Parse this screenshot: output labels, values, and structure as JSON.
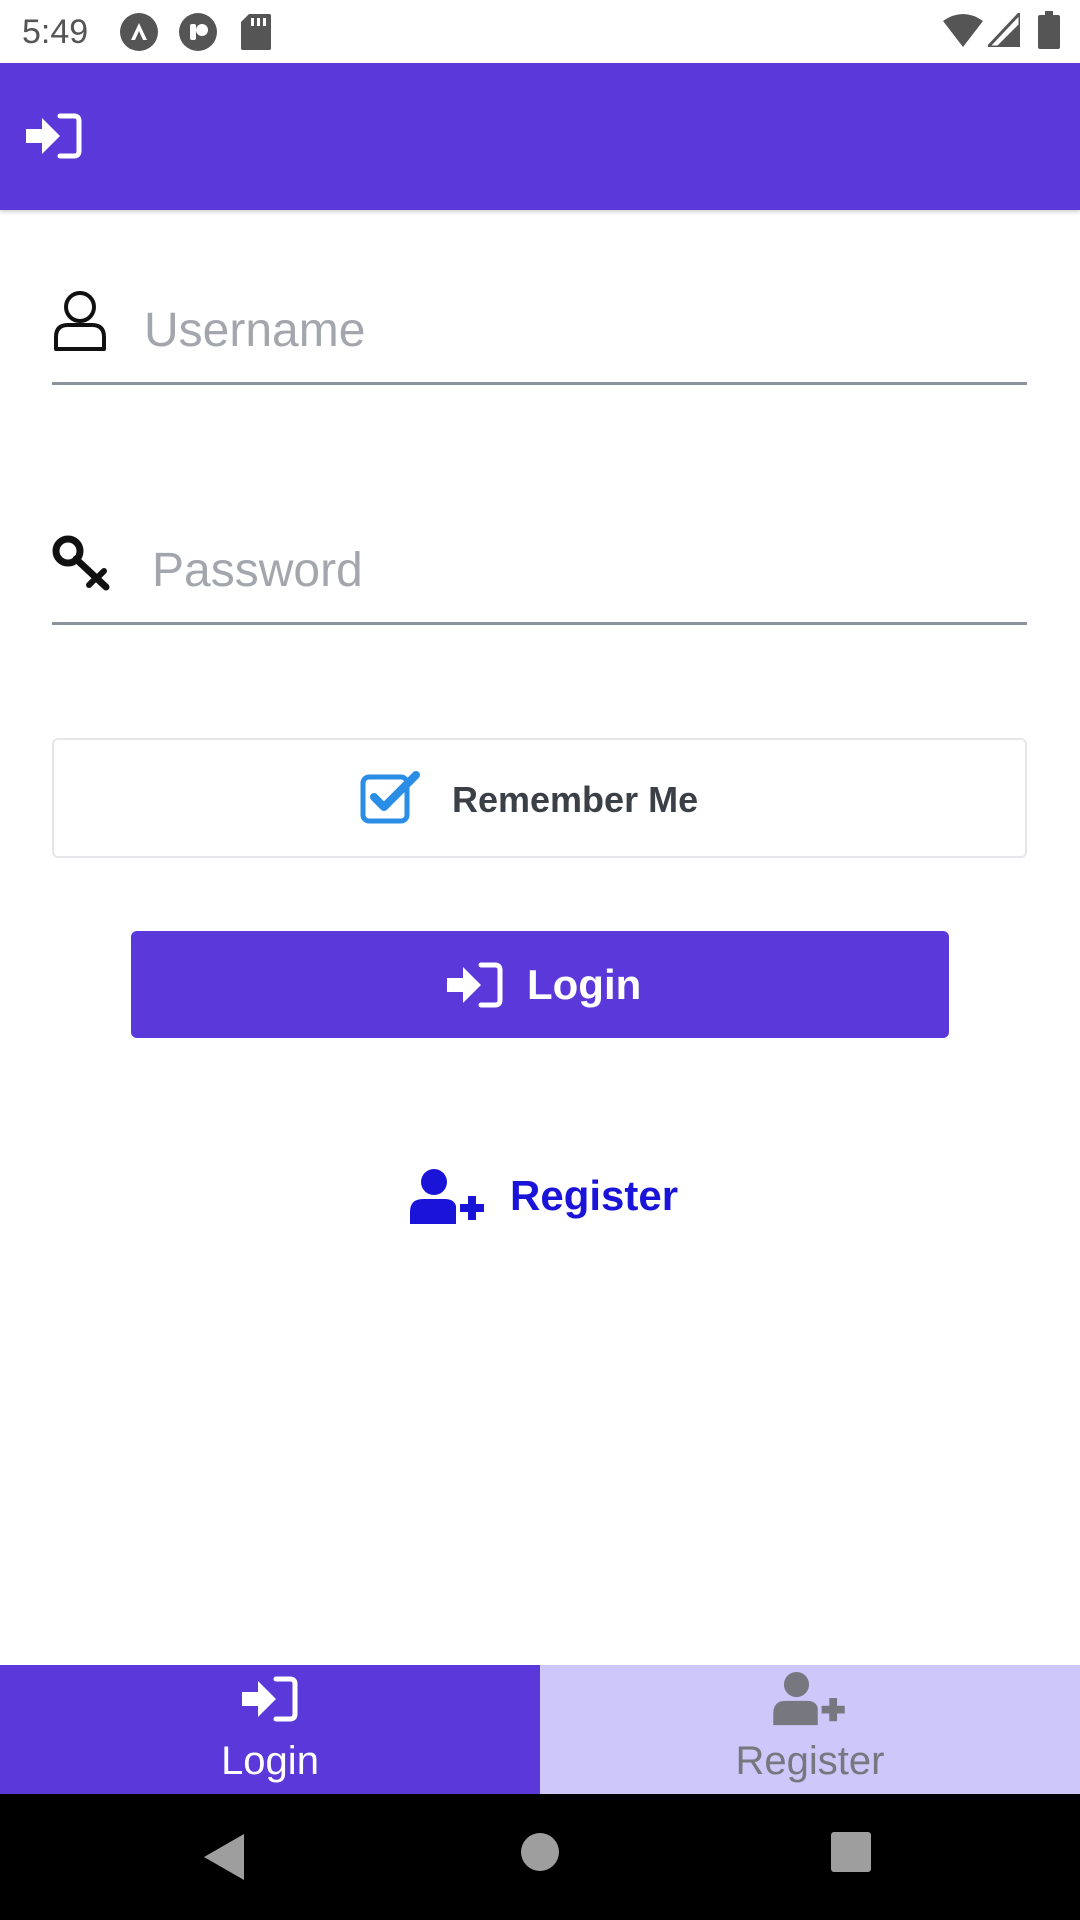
{
  "status_bar": {
    "time": "5:49",
    "icons": [
      "a11y-icon",
      "record-icon",
      "sd-card-icon",
      "wifi-icon",
      "signal-icon",
      "battery-icon"
    ]
  },
  "app_bar": {
    "icon": "login-icon",
    "color": "#5a38d9"
  },
  "form": {
    "username": {
      "icon": "user-icon",
      "value": "",
      "placeholder": "Username"
    },
    "password": {
      "icon": "key-icon",
      "value": "",
      "placeholder": "Password"
    },
    "remember_me": {
      "label": "Remember Me",
      "checked": true,
      "check_color": "#2b8ee6"
    },
    "login_button": {
      "label": "Login",
      "icon": "login-icon"
    },
    "register_link": {
      "label": "Register",
      "icon": "user-plus-icon",
      "color": "#1a14d9"
    }
  },
  "tabs": [
    {
      "label": "Login",
      "icon": "login-icon",
      "selected": true
    },
    {
      "label": "Register",
      "icon": "user-plus-icon",
      "selected": false
    }
  ],
  "colors": {
    "primary": "#5a38d9",
    "tab_inactive": "#cdc7fa"
  }
}
